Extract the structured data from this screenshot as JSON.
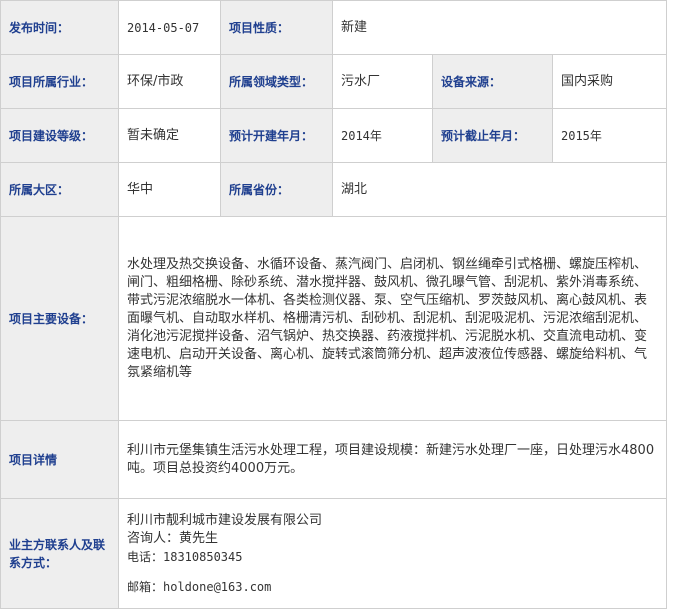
{
  "rows": {
    "publish_time": {
      "label": "发布时间：",
      "value": "2014-05-07"
    },
    "project_nature": {
      "label": "项目性质：",
      "value": "新建"
    },
    "industry": {
      "label": "项目所属行业：",
      "value": "环保/市政"
    },
    "domain_type": {
      "label": "所属领域类型：",
      "value": "污水厂"
    },
    "equip_source": {
      "label": "设备来源：",
      "value": "国内采购"
    },
    "build_level": {
      "label": "项目建设等级：",
      "value": "暂未确定"
    },
    "start_year": {
      "label": "预计开建年月：",
      "value": "2014年"
    },
    "end_year": {
      "label": "预计截止年月：",
      "value": "2015年"
    },
    "region": {
      "label": "所属大区：",
      "value": "华中"
    },
    "province": {
      "label": "所属省份：",
      "value": "湖北"
    },
    "main_equipment": {
      "label": "项目主要设备：",
      "value": "水处理及热交换设备、水循环设备、蒸汽阀门、启闭机、钢丝绳牵引式格栅、螺旋压榨机、闸门、粗细格栅、除砂系统、潜水搅拌器、鼓风机、微孔曝气管、刮泥机、紫外消毒系统、带式污泥浓缩脱水一体机、各类检测仪器、泵、空气压缩机、罗茨鼓风机、离心鼓风机、表面曝气机、自动取水样机、格栅清污机、刮砂机、刮泥机、刮泥吸泥机、污泥浓缩刮泥机、消化池污泥搅拌设备、沼气锅炉、热交换器、药液搅拌机、污泥脱水机、交直流电动机、变速电机、启动开关设备、离心机、旋转式滚筒筛分机、超声波液位传感器、螺旋给料机、气氛紧缩机等"
    },
    "details": {
      "label": "项目详情",
      "value": "利川市元堡集镇生活污水处理工程，项目建设规模：新建污水处理厂一座，日处理污水4800吨。项目总投资约4000万元。"
    },
    "contact": {
      "label": "业主方联系人及联系方式：",
      "company": "利川市靓利城市建设发展有限公司",
      "person": "咨询人：黄先生",
      "phone": "电话：18310850345",
      "email": "邮箱：holdone@163.com"
    }
  }
}
